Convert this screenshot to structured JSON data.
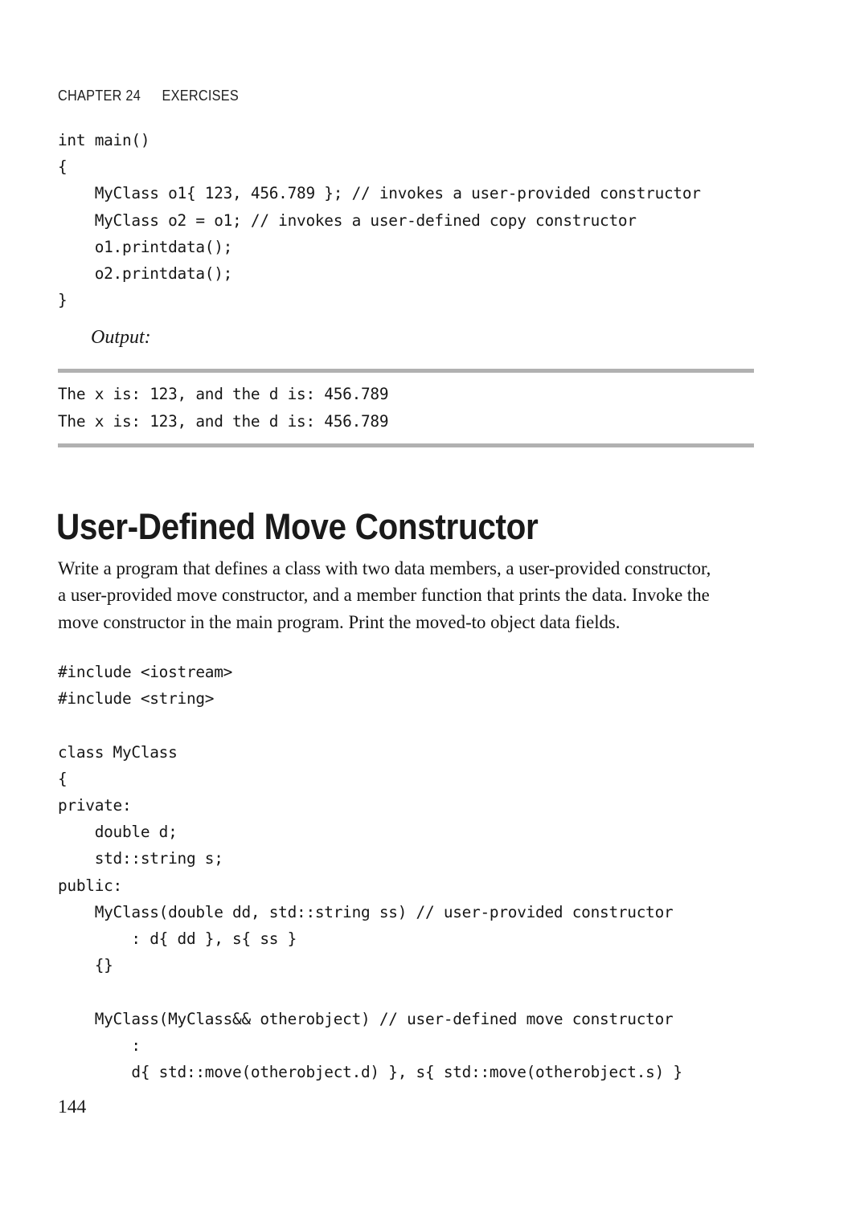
{
  "running_head": {
    "chapter": "CHAPTER 24",
    "section": "EXERCISES"
  },
  "code_main": {
    "lines": [
      "int main()",
      "{",
      "    MyClass o1{ 123, 456.789 }; // invokes a user-provided constructor",
      "    MyClass o2 = o1; // invokes a user-defined copy constructor",
      "    o1.printdata();",
      "    o2.printdata();",
      "}"
    ]
  },
  "output_label": "Output:",
  "output_box": {
    "lines": [
      "The x is: 123, and the d is: 456.789",
      "The x is: 123, and the d is: 456.789"
    ],
    "rule_color": "#b1b1b1"
  },
  "section": {
    "heading": "User-Defined Move Constructor",
    "paragraph": "Write a program that defines a class with two data members, a user-provided constructor, a user-provided move constructor, and a member function that prints the data. Invoke the move constructor in the main program. Print the moved-to object data fields."
  },
  "code_class": {
    "lines": [
      "#include <iostream>",
      "#include <string>",
      "",
      "class MyClass",
      "{",
      "private:",
      "    double d;",
      "    std::string s;",
      "public:",
      "    MyClass(double dd, std::string ss) // user-provided constructor",
      "        : d{ dd }, s{ ss }",
      "    {}",
      "",
      "    MyClass(MyClass&& otherobject) // user-defined move constructor",
      "        :",
      "        d{ std::move(otherobject.d) }, s{ std::move(otherobject.s) }"
    ]
  },
  "folio": "144"
}
